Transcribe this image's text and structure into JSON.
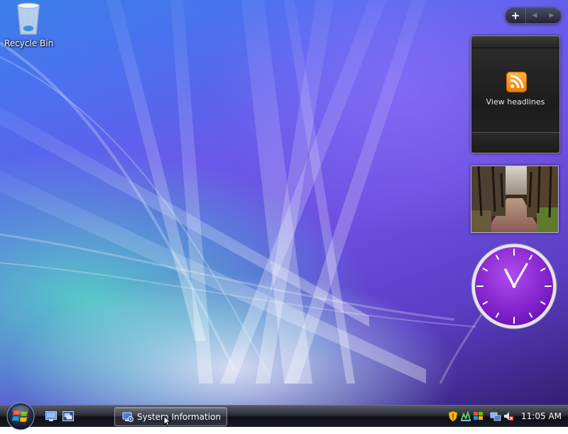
{
  "desktop": {
    "icons": [
      {
        "label": "Recycle Bin",
        "icon": "recycle-bin-icon"
      }
    ]
  },
  "sidebar": {
    "controls": {
      "add": "+",
      "prev": "◀",
      "next": "▶"
    },
    "feed_gadget": {
      "label": "View headlines",
      "icon": "rss-feed-icon",
      "accent": "#f57f17"
    },
    "slideshow_gadget": {
      "content": "forest path photo"
    },
    "clock_gadget": {
      "face_color": "#8a22d8",
      "hour": 11,
      "minute": 5
    }
  },
  "taskbar": {
    "start": {
      "icon": "windows-start-orb-icon"
    },
    "quick_launch": [
      {
        "icon": "show-desktop-icon"
      },
      {
        "icon": "switch-windows-icon"
      }
    ],
    "tasks": [
      {
        "label": "System Information",
        "icon": "system-information-icon",
        "active": true
      }
    ],
    "tray": {
      "icons": [
        "security-alert-icon",
        "network-icon",
        "windows-update-icon",
        "connection-icon",
        "volume-muted-icon"
      ],
      "time": "11:05 AM"
    }
  }
}
